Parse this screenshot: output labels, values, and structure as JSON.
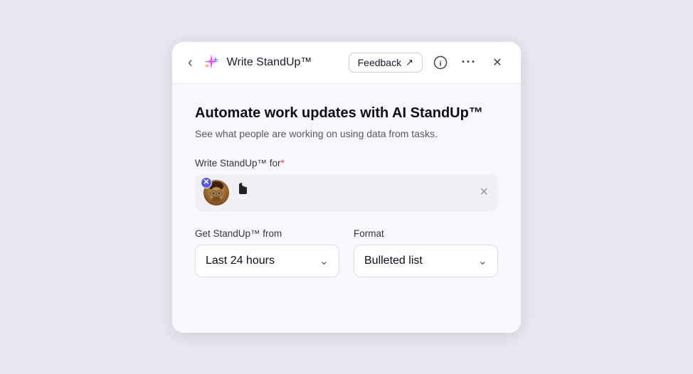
{
  "header": {
    "back_label": "‹",
    "title": "Write StandUp™",
    "feedback_label": "Feedback",
    "feedback_icon": "↗",
    "info_icon": "ⓘ",
    "more_icon": "···",
    "close_icon": "✕"
  },
  "body": {
    "main_title": "Automate work updates with AI StandUp™",
    "sub_text": "See what people are working on using data from tasks.",
    "for_label": "Write StandUp™ for",
    "required_marker": "*",
    "clear_label": "×",
    "avatar_remove_label": "×",
    "get_from_label": "Get StandUp™ from",
    "get_from_value": "Last 24 hours",
    "format_label": "Format",
    "format_value": "Bulleted list"
  }
}
